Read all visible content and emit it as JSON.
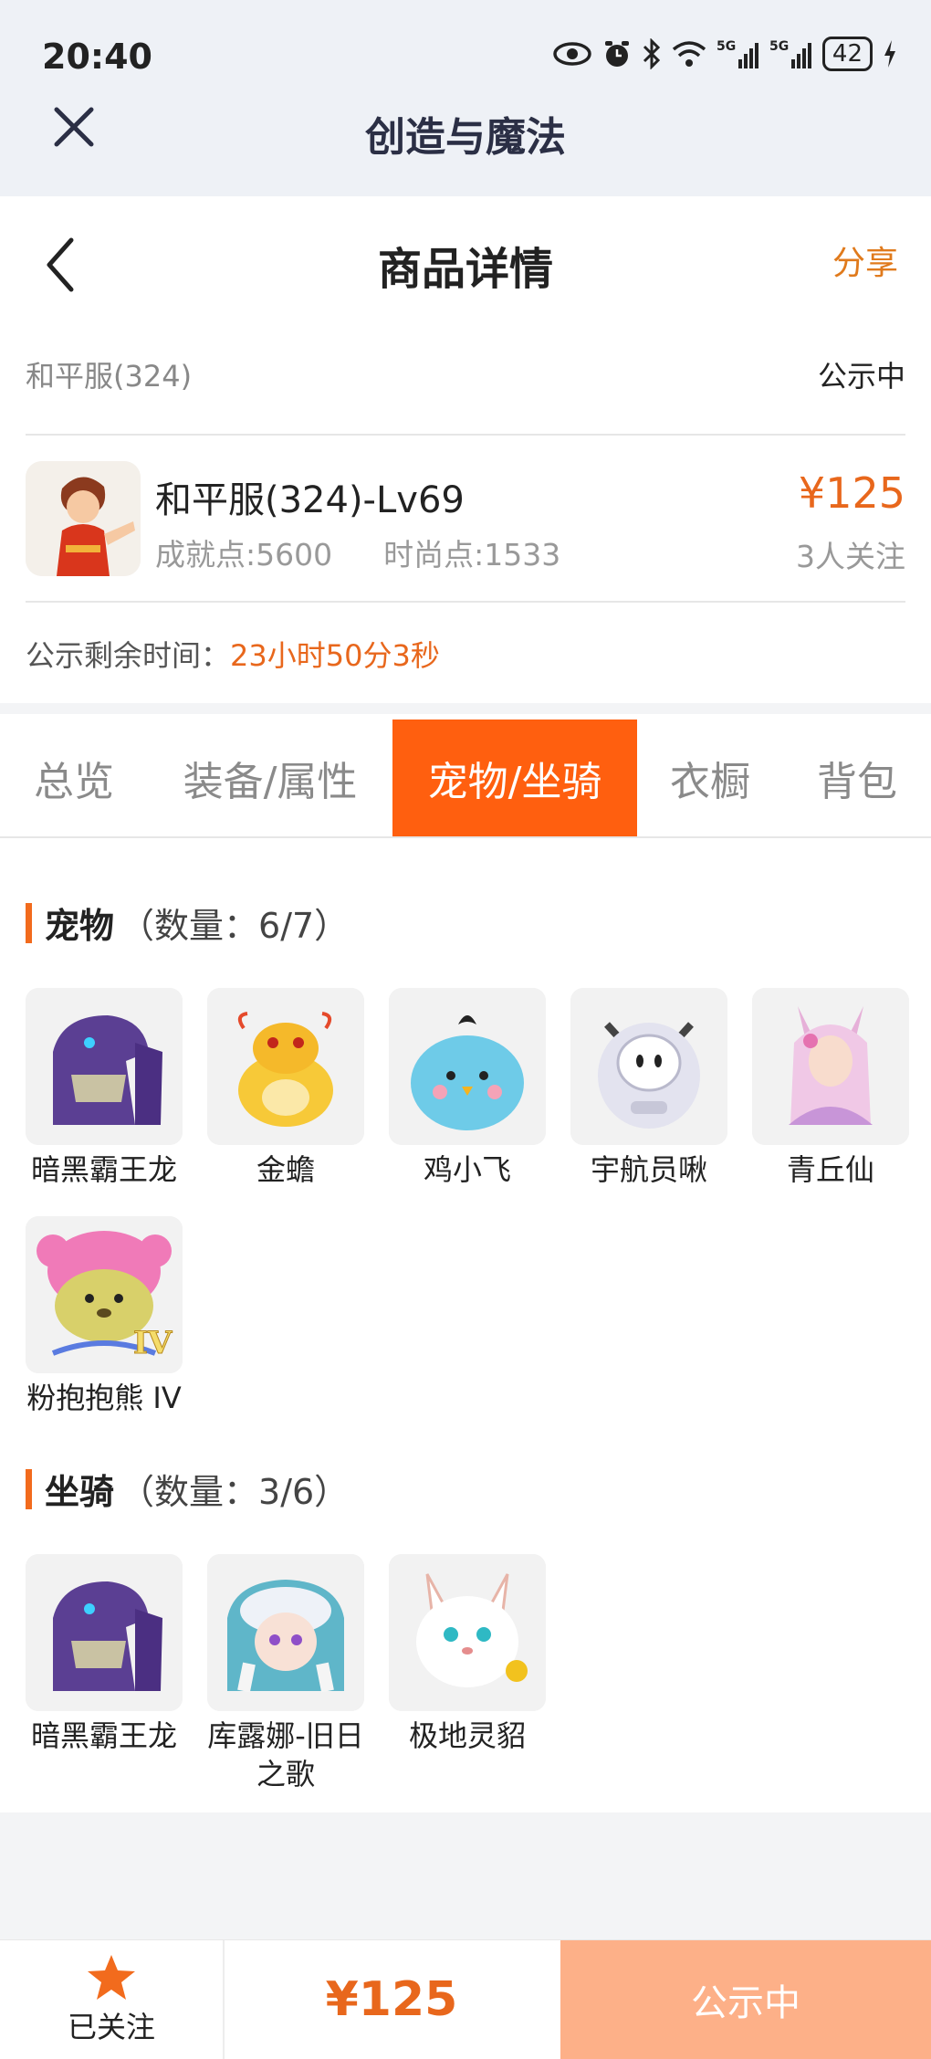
{
  "status_bar": {
    "time": "20:40",
    "battery": "42",
    "icons": [
      "eye-icon",
      "alarm-icon",
      "bluetooth-icon",
      "wifi-icon",
      "signal-5g-icon",
      "signal-5g-icon",
      "battery-icon",
      "charging-icon"
    ],
    "signal_label": "5G"
  },
  "app_bar": {
    "title": "创造与魔法"
  },
  "header": {
    "title": "商品详情",
    "share_label": "分享"
  },
  "server": {
    "name": "和平服(324)",
    "status": "公示中"
  },
  "account": {
    "title": "和平服(324)-Lv69",
    "achievement": "成就点:5600",
    "fashion": "时尚点:1533",
    "price": "¥125",
    "followers": "3人关注"
  },
  "countdown": {
    "label": "公示剩余时间：",
    "value": "23小时50分3秒"
  },
  "tabs": [
    {
      "label": "总览"
    },
    {
      "label": "装备/属性"
    },
    {
      "label": "宠物/坐骑",
      "active": true
    },
    {
      "label": "衣橱"
    },
    {
      "label": "背包"
    }
  ],
  "pets": {
    "title": "宠物",
    "count": "（数量：6/7）",
    "items": [
      {
        "name": "暗黑霸王龙",
        "icon": "purple-dinosaur-icon"
      },
      {
        "name": "金蟾",
        "icon": "golden-toad-icon"
      },
      {
        "name": "鸡小飞",
        "icon": "blue-chick-icon"
      },
      {
        "name": "宇航员啾",
        "icon": "astronaut-icon"
      },
      {
        "name": "青丘仙",
        "icon": "fox-fairy-icon"
      },
      {
        "name": "粉抱抱熊 IV",
        "icon": "pink-bear-icon",
        "badge": "IV"
      }
    ]
  },
  "mounts": {
    "title": "坐骑",
    "count": "（数量：3/6）",
    "items": [
      {
        "name": "暗黑霸王龙",
        "icon": "purple-dinosaur-icon"
      },
      {
        "name": "库露娜-旧日之歌",
        "icon": "kuluna-icon"
      },
      {
        "name": "极地灵貂",
        "icon": "white-mink-icon"
      }
    ]
  },
  "bottom_bar": {
    "follow_label": "已关注",
    "price": "¥125",
    "action_label": "公示中"
  },
  "colors": {
    "accent": "#ff5f0f",
    "price": "#e8671c",
    "action_button": "#fdb088",
    "star": "#f26b1d"
  }
}
